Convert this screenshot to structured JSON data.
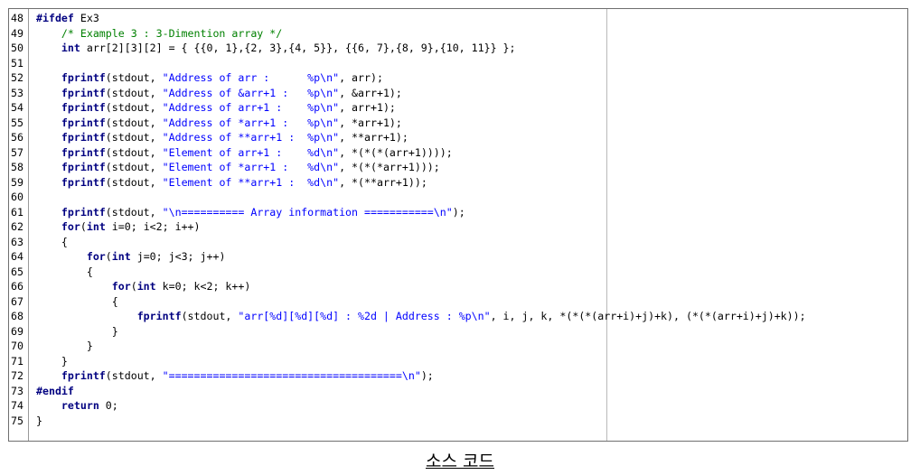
{
  "editor": {
    "lines": [
      {
        "num": "48",
        "tokens": [
          {
            "t": "#ifdef",
            "c": "pp"
          },
          {
            "t": " Ex3",
            "c": "plain"
          }
        ]
      },
      {
        "num": "49",
        "tokens": [
          {
            "t": "    ",
            "c": "plain"
          },
          {
            "t": "/* Example 3 : 3-Dimention array */",
            "c": "cm"
          }
        ]
      },
      {
        "num": "50",
        "tokens": [
          {
            "t": "    ",
            "c": "plain"
          },
          {
            "t": "int",
            "c": "kw"
          },
          {
            "t": " arr[2][3][2] = { {{0, 1},{2, 3},{4, 5}}, {{6, 7},{8, 9},{10, 11}} };",
            "c": "plain"
          }
        ]
      },
      {
        "num": "51",
        "tokens": []
      },
      {
        "num": "52",
        "tokens": [
          {
            "t": "    ",
            "c": "plain"
          },
          {
            "t": "fprintf",
            "c": "kw"
          },
          {
            "t": "(stdout, ",
            "c": "plain"
          },
          {
            "t": "\"Address of arr :      %p\\n\"",
            "c": "str"
          },
          {
            "t": ", arr);",
            "c": "plain"
          }
        ]
      },
      {
        "num": "53",
        "tokens": [
          {
            "t": "    ",
            "c": "plain"
          },
          {
            "t": "fprintf",
            "c": "kw"
          },
          {
            "t": "(stdout, ",
            "c": "plain"
          },
          {
            "t": "\"Address of &arr+1 :   %p\\n\"",
            "c": "str"
          },
          {
            "t": ", &arr+1);",
            "c": "plain"
          }
        ]
      },
      {
        "num": "54",
        "tokens": [
          {
            "t": "    ",
            "c": "plain"
          },
          {
            "t": "fprintf",
            "c": "kw"
          },
          {
            "t": "(stdout, ",
            "c": "plain"
          },
          {
            "t": "\"Address of arr+1 :    %p\\n\"",
            "c": "str"
          },
          {
            "t": ", arr+1);",
            "c": "plain"
          }
        ]
      },
      {
        "num": "55",
        "tokens": [
          {
            "t": "    ",
            "c": "plain"
          },
          {
            "t": "fprintf",
            "c": "kw"
          },
          {
            "t": "(stdout, ",
            "c": "plain"
          },
          {
            "t": "\"Address of *arr+1 :   %p\\n\"",
            "c": "str"
          },
          {
            "t": ", *arr+1);",
            "c": "plain"
          }
        ]
      },
      {
        "num": "56",
        "tokens": [
          {
            "t": "    ",
            "c": "plain"
          },
          {
            "t": "fprintf",
            "c": "kw"
          },
          {
            "t": "(stdout, ",
            "c": "plain"
          },
          {
            "t": "\"Address of **arr+1 :  %p\\n\"",
            "c": "str"
          },
          {
            "t": ", **arr+1);",
            "c": "plain"
          }
        ]
      },
      {
        "num": "57",
        "tokens": [
          {
            "t": "    ",
            "c": "plain"
          },
          {
            "t": "fprintf",
            "c": "kw"
          },
          {
            "t": "(stdout, ",
            "c": "plain"
          },
          {
            "t": "\"Element of arr+1 :    %d\\n\"",
            "c": "str"
          },
          {
            "t": ", *(*(*(arr+1))));",
            "c": "plain"
          }
        ]
      },
      {
        "num": "58",
        "tokens": [
          {
            "t": "    ",
            "c": "plain"
          },
          {
            "t": "fprintf",
            "c": "kw"
          },
          {
            "t": "(stdout, ",
            "c": "plain"
          },
          {
            "t": "\"Element of *arr+1 :   %d\\n\"",
            "c": "str"
          },
          {
            "t": ", *(*(*arr+1)));",
            "c": "plain"
          }
        ]
      },
      {
        "num": "59",
        "tokens": [
          {
            "t": "    ",
            "c": "plain"
          },
          {
            "t": "fprintf",
            "c": "kw"
          },
          {
            "t": "(stdout, ",
            "c": "plain"
          },
          {
            "t": "\"Element of **arr+1 :  %d\\n\"",
            "c": "str"
          },
          {
            "t": ", *(**arr+1));",
            "c": "plain"
          }
        ]
      },
      {
        "num": "60",
        "tokens": []
      },
      {
        "num": "61",
        "tokens": [
          {
            "t": "    ",
            "c": "plain"
          },
          {
            "t": "fprintf",
            "c": "kw"
          },
          {
            "t": "(stdout, ",
            "c": "plain"
          },
          {
            "t": "\"\\n========== Array information ===========\\n\"",
            "c": "str"
          },
          {
            "t": ");",
            "c": "plain"
          }
        ]
      },
      {
        "num": "62",
        "tokens": [
          {
            "t": "    ",
            "c": "plain"
          },
          {
            "t": "for",
            "c": "kw"
          },
          {
            "t": "(",
            "c": "plain"
          },
          {
            "t": "int",
            "c": "kw"
          },
          {
            "t": " i=0; i<2; i++)",
            "c": "plain"
          }
        ]
      },
      {
        "num": "63",
        "tokens": [
          {
            "t": "    {",
            "c": "plain"
          }
        ]
      },
      {
        "num": "64",
        "tokens": [
          {
            "t": "        ",
            "c": "plain"
          },
          {
            "t": "for",
            "c": "kw"
          },
          {
            "t": "(",
            "c": "plain"
          },
          {
            "t": "int",
            "c": "kw"
          },
          {
            "t": " j=0; j<3; j++)",
            "c": "plain"
          }
        ]
      },
      {
        "num": "65",
        "tokens": [
          {
            "t": "        {",
            "c": "plain"
          }
        ]
      },
      {
        "num": "66",
        "tokens": [
          {
            "t": "            ",
            "c": "plain"
          },
          {
            "t": "for",
            "c": "kw"
          },
          {
            "t": "(",
            "c": "plain"
          },
          {
            "t": "int",
            "c": "kw"
          },
          {
            "t": " k=0; k<2; k++)",
            "c": "plain"
          }
        ]
      },
      {
        "num": "67",
        "tokens": [
          {
            "t": "            {",
            "c": "plain"
          }
        ]
      },
      {
        "num": "68",
        "tokens": [
          {
            "t": "                ",
            "c": "plain"
          },
          {
            "t": "fprintf",
            "c": "kw"
          },
          {
            "t": "(stdout, ",
            "c": "plain"
          },
          {
            "t": "\"arr[%d][%d][%d] : %2d | Address : %p\\n\"",
            "c": "str"
          },
          {
            "t": ", i, j, k, *(*(*(arr+i)+j)+k), (*(*(arr+i)+j)+k));",
            "c": "plain"
          }
        ]
      },
      {
        "num": "69",
        "tokens": [
          {
            "t": "            }",
            "c": "plain"
          }
        ]
      },
      {
        "num": "70",
        "tokens": [
          {
            "t": "        }",
            "c": "plain"
          }
        ]
      },
      {
        "num": "71",
        "tokens": [
          {
            "t": "    }",
            "c": "plain"
          }
        ]
      },
      {
        "num": "72",
        "tokens": [
          {
            "t": "    ",
            "c": "plain"
          },
          {
            "t": "fprintf",
            "c": "kw"
          },
          {
            "t": "(stdout, ",
            "c": "plain"
          },
          {
            "t": "\"=====================================\\n\"",
            "c": "str"
          },
          {
            "t": ");",
            "c": "plain"
          }
        ]
      },
      {
        "num": "73",
        "tokens": [
          {
            "t": "#endif",
            "c": "pp"
          }
        ]
      },
      {
        "num": "74",
        "tokens": [
          {
            "t": "    ",
            "c": "plain"
          },
          {
            "t": "return",
            "c": "kw"
          },
          {
            "t": " 0;",
            "c": "plain"
          }
        ]
      },
      {
        "num": "75",
        "tokens": [
          {
            "t": "}",
            "c": "plain"
          }
        ]
      }
    ],
    "colors": {
      "keyword": "#000080",
      "string": "#0000ff",
      "comment": "#008000",
      "text": "#000000"
    }
  },
  "caption": "소스 코드"
}
